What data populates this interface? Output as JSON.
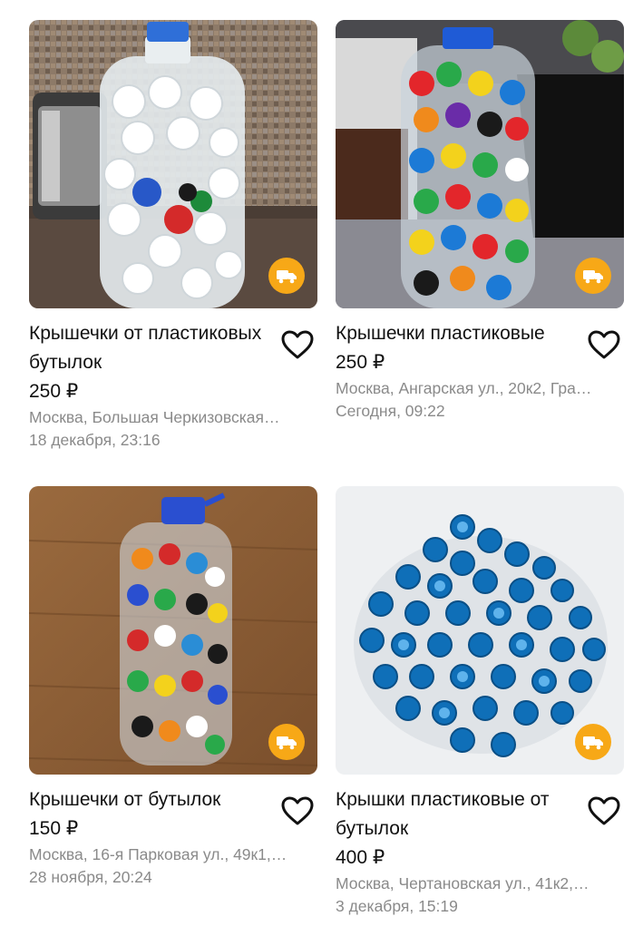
{
  "listings": [
    {
      "title": "Крышечки от пластиковых бутылок",
      "price": "250 ₽",
      "address": "Москва, Большая Черкизовская…",
      "date": "18 декабря, 23:16",
      "photo_icon": "bottle-white-caps-photo",
      "delivery_icon": "truck-icon",
      "favorite_icon": "heart-outline-icon"
    },
    {
      "title": "Крышечки пластиковые",
      "price": "250 ₽",
      "address": "Москва, Ангарская ул., 20к2, Гра…",
      "date": "Сегодня, 09:22",
      "photo_icon": "bottle-colored-caps-photo",
      "delivery_icon": "truck-icon",
      "favorite_icon": "heart-outline-icon"
    },
    {
      "title": "Крышечки от бутылок",
      "price": "150 ₽",
      "address": "Москва, 16-я Парковая ул., 49к1,…",
      "date": "28 ноября, 20:24",
      "photo_icon": "bottle-on-floor-photo",
      "delivery_icon": "truck-icon",
      "favorite_icon": "heart-outline-icon"
    },
    {
      "title": "Крышки пластиковые от бутылок",
      "price": "400 ₽",
      "address": "Москва, Чертановская ул., 41к2,…",
      "date": "3 декабря, 15:19",
      "photo_icon": "blue-caps-pile-photo",
      "delivery_icon": "truck-icon",
      "favorite_icon": "heart-outline-icon"
    }
  ],
  "colors": {
    "delivery_badge": "#f7a817",
    "meta_text": "#8a8a8a",
    "primary_text": "#111111"
  }
}
